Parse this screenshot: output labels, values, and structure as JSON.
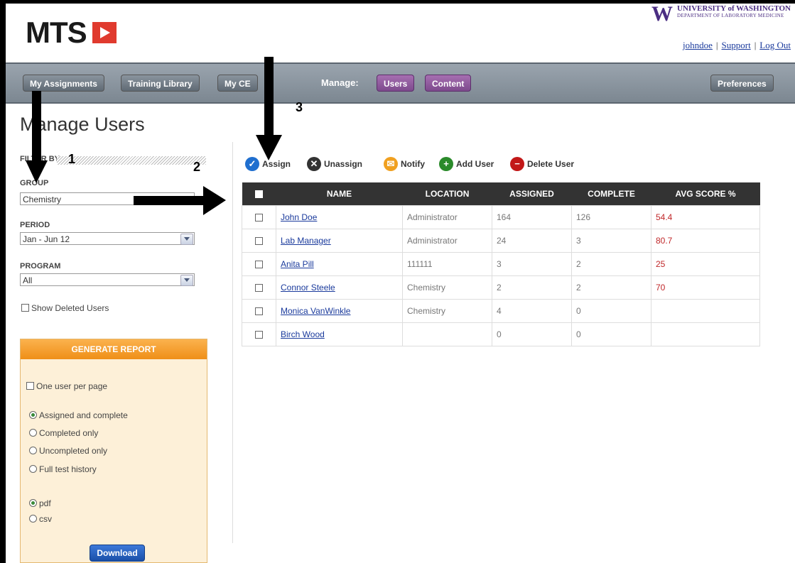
{
  "header": {
    "logo_text": "MTS",
    "uw_mark": "W",
    "uw_line1": "UNIVERSITY of WASHINGTON",
    "uw_line2": "DEPARTMENT OF LABORATORY MEDICINE",
    "user_links": [
      "johndoe",
      "Support",
      "Log Out"
    ]
  },
  "nav": {
    "tabs": [
      "My Assignments",
      "Training Library",
      "My CE"
    ],
    "manage_label": "Manage:",
    "manage_tabs": [
      "Users",
      "Content"
    ],
    "preferences": "Preferences"
  },
  "sidebar": {
    "page_title": "Manage Users",
    "filter_label": "FILTER BY:",
    "group_label": "GROUP",
    "group_value": "Chemistry",
    "period_label": "PERIOD",
    "period_value": "Jan - Jun 12",
    "program_label": "PROGRAM",
    "program_value": "All",
    "show_deleted": "Show Deleted Users"
  },
  "report": {
    "title": "GENERATE REPORT",
    "one_per_page": "One user per page",
    "options": [
      "Assigned and complete",
      "Completed only",
      "Uncompleted only",
      "Full test history"
    ],
    "formats": [
      "pdf",
      "csv"
    ],
    "download": "Download"
  },
  "toolbar": {
    "assign": "Assign",
    "unassign": "Unassign",
    "notify": "Notify",
    "add_user": "Add User",
    "delete_user": "Delete User"
  },
  "table": {
    "columns": [
      "NAME",
      "LOCATION",
      "ASSIGNED",
      "COMPLETE",
      "AVG SCORE %"
    ],
    "rows": [
      {
        "name": "John Doe",
        "location": "Administrator",
        "assigned": "164",
        "complete": "126",
        "score": "54.4"
      },
      {
        "name": "Lab Manager",
        "location": "Administrator",
        "assigned": "24",
        "complete": "3",
        "score": "80.7"
      },
      {
        "name": "Anita Pill",
        "location": "111111",
        "assigned": "3",
        "complete": "2",
        "score": "25"
      },
      {
        "name": "Connor Steele",
        "location": "Chemistry",
        "assigned": "2",
        "complete": "2",
        "score": "70"
      },
      {
        "name": "Monica VanWinkle",
        "location": "Chemistry",
        "assigned": "4",
        "complete": "0",
        "score": ""
      },
      {
        "name": "Birch Wood",
        "location": "",
        "assigned": "0",
        "complete": "0",
        "score": ""
      }
    ]
  },
  "annotations": [
    "1",
    "2",
    "3"
  ],
  "colors": {
    "brand_red": "#e03a2e",
    "uw_purple": "#4b2e83",
    "nav_gray": "#8a949e",
    "manage_purple": "#7d4a8d",
    "report_orange": "#ef8f17",
    "score_red": "#c0282a",
    "table_header": "#333333"
  }
}
